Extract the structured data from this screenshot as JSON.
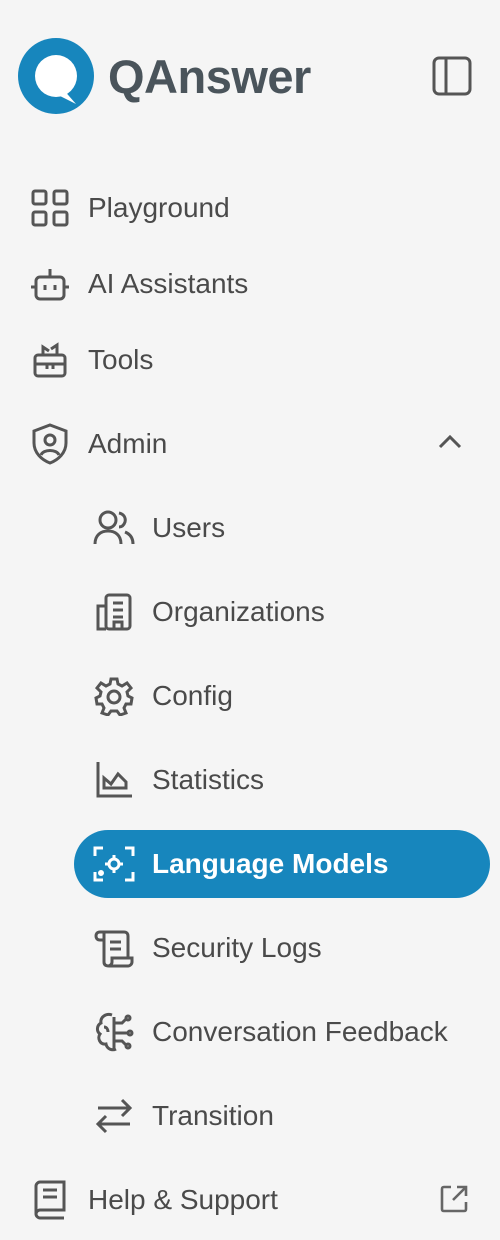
{
  "brand": {
    "name": "QAnswer",
    "accent_color": "#1786bd",
    "logo_icon": "chat-bubble-logo-icon"
  },
  "header": {
    "collapse_icon": "sidebar-toggle-icon"
  },
  "nav": {
    "items": [
      {
        "label": "Playground",
        "icon": "grid-icon"
      },
      {
        "label": "AI Assistants",
        "icon": "robot-icon"
      },
      {
        "label": "Tools",
        "icon": "toolbox-icon"
      },
      {
        "label": "Admin",
        "icon": "shield-user-icon",
        "expanded": true
      }
    ],
    "admin_sub": [
      {
        "label": "Users",
        "icon": "users-icon"
      },
      {
        "label": "Organizations",
        "icon": "building-icon"
      },
      {
        "label": "Config",
        "icon": "gear-icon"
      },
      {
        "label": "Statistics",
        "icon": "chart-icon"
      },
      {
        "label": "Language Models",
        "icon": "chip-icon",
        "active": true
      },
      {
        "label": "Security Logs",
        "icon": "scroll-icon"
      },
      {
        "label": "Conversation Feedback",
        "icon": "brain-icon"
      },
      {
        "label": "Transition",
        "icon": "arrows-swap-icon"
      }
    ],
    "help": {
      "label": "Help & Support",
      "icon": "book-icon",
      "external_icon": "external-link-icon"
    }
  }
}
